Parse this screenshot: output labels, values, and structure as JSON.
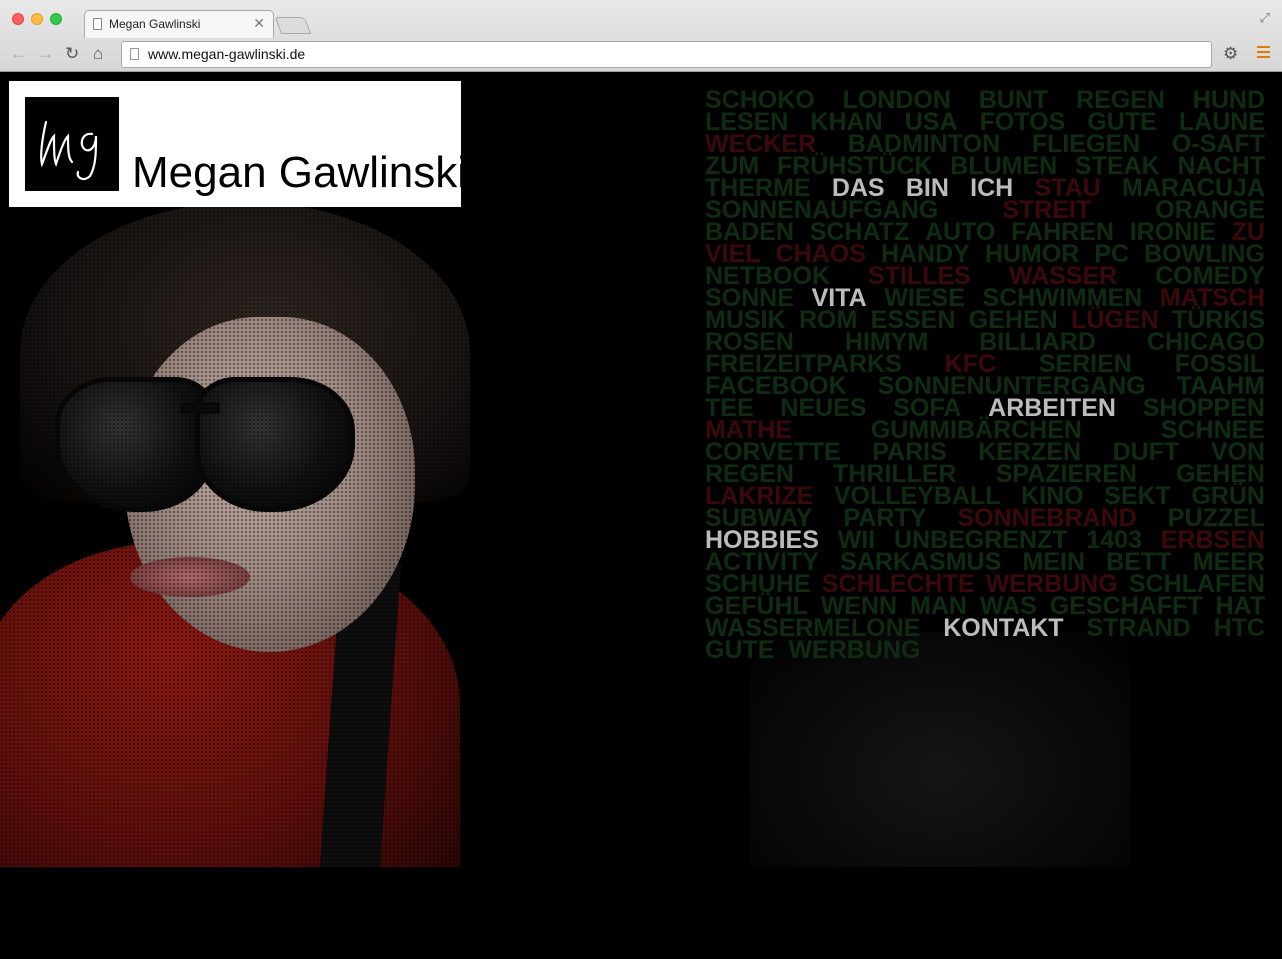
{
  "browser": {
    "tab_title": "Megan Gawlinski",
    "url": "www.megan-gawlinski.de",
    "accent_color": "#e07b00"
  },
  "logo": {
    "monogram": "mg",
    "name": "Megan Gawlinski"
  },
  "colors": {
    "background": "#000000",
    "word_green": "#0f2c13",
    "word_red": "#3b090b",
    "nav": "#bcbcbc"
  },
  "nav": [
    "DAS BIN ICH",
    "VITA",
    "ARBEITEN",
    "HOBBIES",
    "KONTAKT"
  ],
  "word_cloud": {
    "lines": [
      [
        {
          "t": "SCHOKO",
          "c": "g"
        },
        {
          "t": "LONDON",
          "c": "g"
        },
        {
          "t": "BUNT",
          "c": "g"
        },
        {
          "t": "REGEN",
          "c": "g"
        },
        {
          "t": "HUND",
          "c": "g"
        }
      ],
      [
        {
          "t": "LESEN",
          "c": "g"
        },
        {
          "t": "KHAN",
          "c": "g"
        },
        {
          "t": "USA",
          "c": "g"
        },
        {
          "t": "FOTOS",
          "c": "g"
        },
        {
          "t": "GUTE",
          "c": "g"
        },
        {
          "t": "LAUNE",
          "c": "g"
        }
      ],
      [
        {
          "t": "WECKER",
          "c": "r"
        },
        {
          "t": "BADMINTON",
          "c": "g"
        },
        {
          "t": "FLIEGEN",
          "c": "g"
        },
        {
          "t": "O-SAFT",
          "c": "g"
        }
      ],
      [
        {
          "t": "ZUM",
          "c": "g"
        },
        {
          "t": "FRÜHSTÜCK",
          "c": "g"
        },
        {
          "t": "BLUMEN",
          "c": "g"
        },
        {
          "t": "STEAK",
          "c": "g"
        },
        {
          "t": "NACHT",
          "c": "g"
        }
      ],
      [
        {
          "t": "THERME",
          "c": "g"
        },
        {
          "t": "DAS",
          "c": "n"
        },
        {
          "t": "BIN",
          "c": "n"
        },
        {
          "t": "ICH",
          "c": "n"
        },
        {
          "t": "STAU",
          "c": "r"
        },
        {
          "t": "MARACUJA",
          "c": "g"
        }
      ],
      [
        {
          "t": "SONNENAUFGANG",
          "c": "g"
        },
        {
          "t": "STREIT",
          "c": "r"
        },
        {
          "t": "ORANGE",
          "c": "g"
        }
      ],
      [
        {
          "t": "BADEN",
          "c": "g"
        },
        {
          "t": "SCHATZ",
          "c": "g"
        },
        {
          "t": "AUTO",
          "c": "g"
        },
        {
          "t": "FAHREN",
          "c": "g"
        },
        {
          "t": "IRONIE",
          "c": "g"
        },
        {
          "t": "ZU",
          "c": "r"
        }
      ],
      [
        {
          "t": "VIEL",
          "c": "r"
        },
        {
          "t": "CHAOS",
          "c": "r"
        },
        {
          "t": "HANDY",
          "c": "g"
        },
        {
          "t": "HUMOR",
          "c": "g"
        },
        {
          "t": "PC",
          "c": "g"
        },
        {
          "t": "BOWLING",
          "c": "g"
        }
      ],
      [
        {
          "t": "NETBOOK",
          "c": "g"
        },
        {
          "t": "STILLES",
          "c": "r"
        },
        {
          "t": "WASSER",
          "c": "r"
        },
        {
          "t": "COMEDY",
          "c": "g"
        }
      ],
      [
        {
          "t": "SONNE",
          "c": "g"
        },
        {
          "t": "VITA",
          "c": "n"
        },
        {
          "t": "WIESE",
          "c": "g"
        },
        {
          "t": "SCHWIMMEN",
          "c": "g"
        },
        {
          "t": "MATSCH",
          "c": "r"
        }
      ],
      [
        {
          "t": "MUSIK",
          "c": "g"
        },
        {
          "t": "ROM",
          "c": "g"
        },
        {
          "t": "ESSEN",
          "c": "g"
        },
        {
          "t": "GEHEN",
          "c": "g"
        },
        {
          "t": "LÜGEN",
          "c": "r"
        },
        {
          "t": "TÜRKIS",
          "c": "g"
        }
      ],
      [
        {
          "t": "ROSEN",
          "c": "g"
        },
        {
          "t": "HIMYM",
          "c": "g"
        },
        {
          "t": "BILLIARD",
          "c": "g"
        },
        {
          "t": "CHICAGO",
          "c": "g"
        }
      ],
      [
        {
          "t": "FREIZEITPARKS",
          "c": "g"
        },
        {
          "t": "KFC",
          "c": "r"
        },
        {
          "t": "SERIEN",
          "c": "g"
        },
        {
          "t": "FOSSIL",
          "c": "g"
        }
      ],
      [
        {
          "t": "FACEBOOK",
          "c": "g"
        },
        {
          "t": "SONNENUNTERGANG",
          "c": "g"
        },
        {
          "t": "TAAHM",
          "c": "g"
        }
      ],
      [
        {
          "t": "TEE",
          "c": "g"
        },
        {
          "t": "NEUES",
          "c": "g"
        },
        {
          "t": "SOFA",
          "c": "g"
        },
        {
          "t": "ARBEITEN",
          "c": "n"
        },
        {
          "t": "SHOPPEN",
          "c": "g"
        }
      ],
      [
        {
          "t": "MATHE",
          "c": "r"
        },
        {
          "t": "GUMMIBÄRCHEN",
          "c": "g"
        },
        {
          "t": "SCHNEE",
          "c": "g"
        }
      ],
      [
        {
          "t": "CORVETTE",
          "c": "g"
        },
        {
          "t": "PARIS",
          "c": "g"
        },
        {
          "t": "KERZEN",
          "c": "g"
        },
        {
          "t": "DUFT",
          "c": "g"
        },
        {
          "t": "VON",
          "c": "g"
        }
      ],
      [
        {
          "t": "REGEN",
          "c": "g"
        },
        {
          "t": "THRILLER",
          "c": "g"
        },
        {
          "t": "SPAZIEREN",
          "c": "g"
        },
        {
          "t": "GEHEN",
          "c": "g"
        }
      ],
      [
        {
          "t": "LAKRIZE",
          "c": "r"
        },
        {
          "t": "VOLLEYBALL",
          "c": "g"
        },
        {
          "t": "KINO",
          "c": "g"
        },
        {
          "t": "SEKT",
          "c": "g"
        },
        {
          "t": "GRÜN",
          "c": "g"
        }
      ],
      [
        {
          "t": "SUBWAY",
          "c": "g"
        },
        {
          "t": "PARTY",
          "c": "g"
        },
        {
          "t": "SONNEBRAND",
          "c": "r"
        },
        {
          "t": "PUZZEL",
          "c": "g"
        }
      ],
      [
        {
          "t": "HOBBIES",
          "c": "n"
        },
        {
          "t": "WII",
          "c": "g"
        },
        {
          "t": "UNBEGRENZT",
          "c": "g"
        },
        {
          "t": "1403",
          "c": "g"
        },
        {
          "t": "ERBSEN",
          "c": "r"
        }
      ],
      [
        {
          "t": "ACTIVITY",
          "c": "g"
        },
        {
          "t": "SARKASMUS",
          "c": "g"
        },
        {
          "t": "MEIN",
          "c": "g"
        },
        {
          "t": "BETT",
          "c": "g"
        },
        {
          "t": "MEER",
          "c": "g"
        }
      ],
      [
        {
          "t": "SCHUHE",
          "c": "g"
        },
        {
          "t": "SCHLECHTE",
          "c": "r"
        },
        {
          "t": "WERBUNG",
          "c": "r"
        },
        {
          "t": "SCHLAFEN",
          "c": "g"
        }
      ],
      [
        {
          "t": "GEFÜHL",
          "c": "g"
        },
        {
          "t": "WENN",
          "c": "g"
        },
        {
          "t": "MAN",
          "c": "g"
        },
        {
          "t": "WAS",
          "c": "g"
        },
        {
          "t": "GESCHAFFT",
          "c": "g"
        },
        {
          "t": "HAT",
          "c": "g"
        }
      ],
      [
        {
          "t": "WASSERMELONE",
          "c": "g"
        },
        {
          "t": "KONTAKT",
          "c": "n"
        },
        {
          "t": "STRAND",
          "c": "g"
        },
        {
          "t": "HTC",
          "c": "g"
        }
      ],
      [
        {
          "t": "GUTE",
          "c": "g"
        },
        {
          "t": "WERBUNG",
          "c": "g"
        }
      ]
    ]
  }
}
